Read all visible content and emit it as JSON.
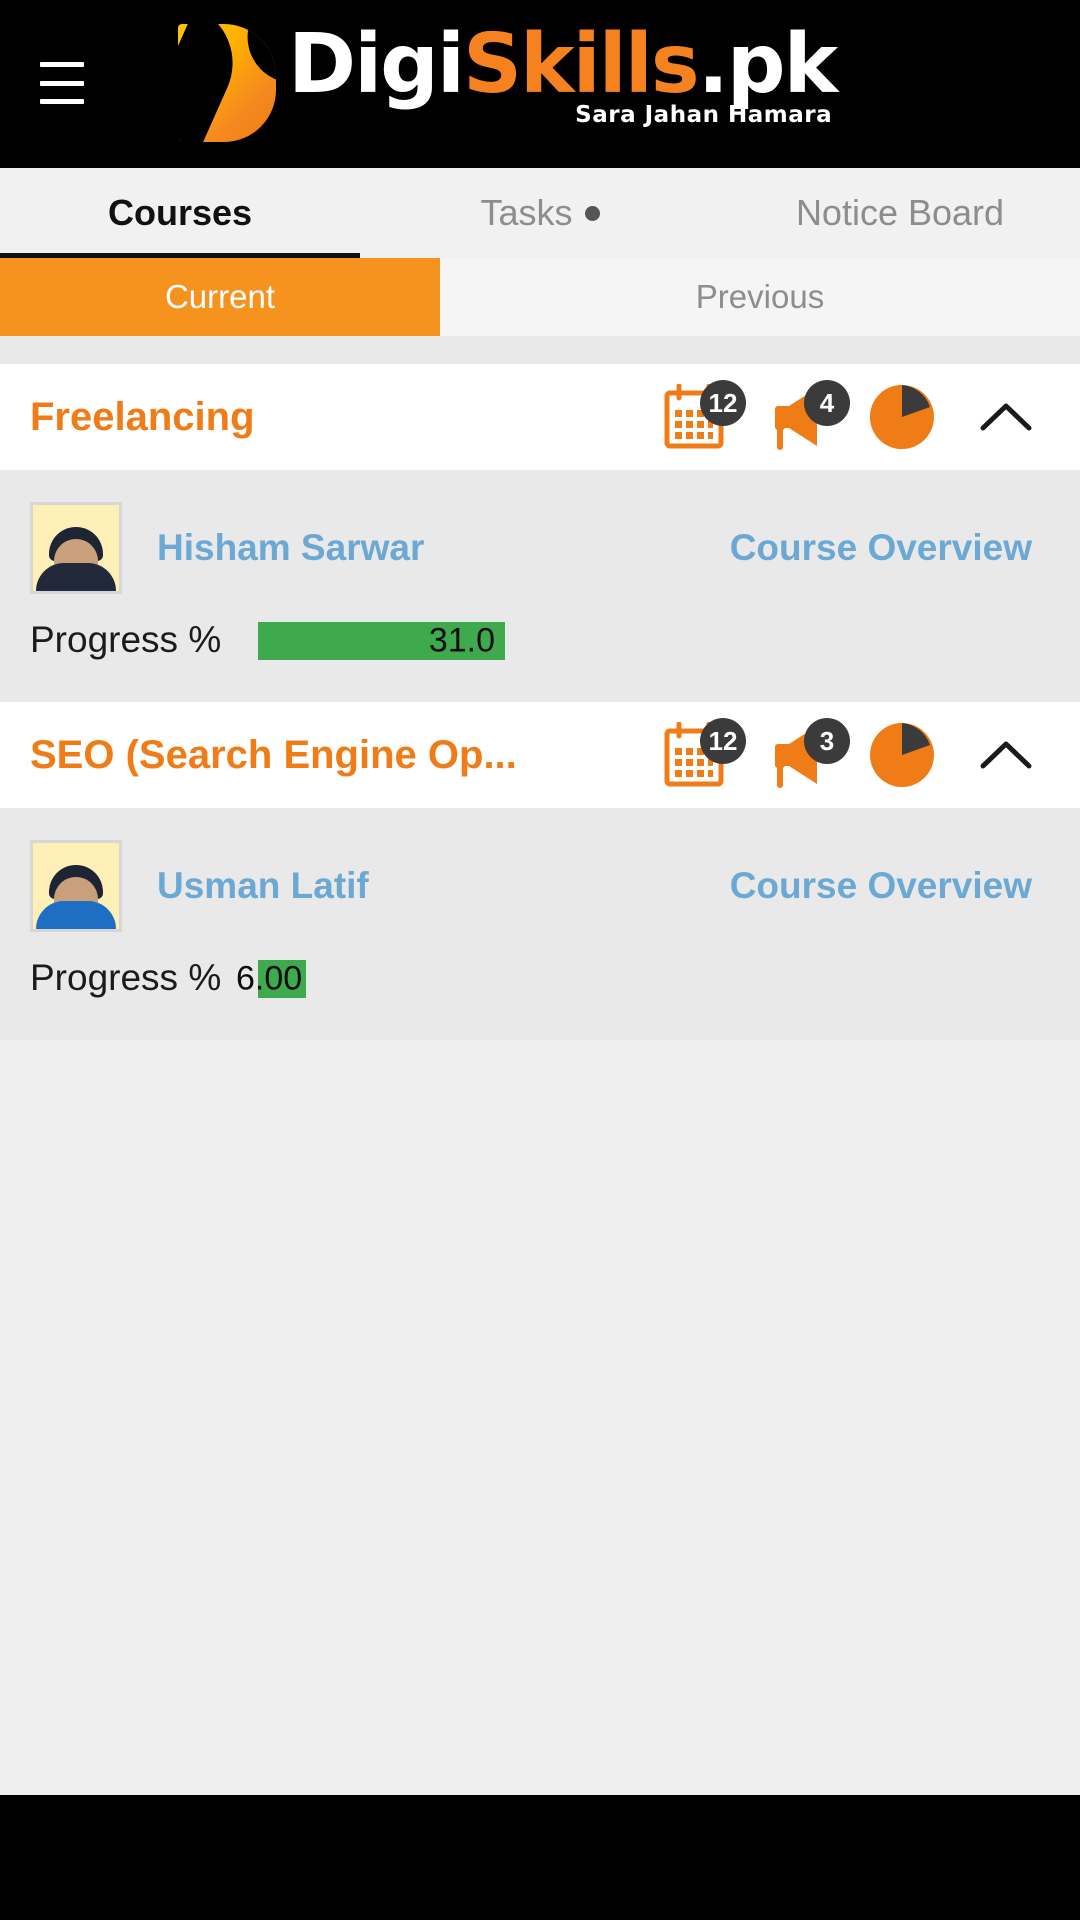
{
  "header": {
    "menu_icon": "hamburger-menu-icon",
    "logo": {
      "part1": "Digi",
      "part2": "Skills",
      "part3": ".pk",
      "tagline": "Sara Jahan Hamara"
    }
  },
  "tabs": [
    {
      "label": "Courses",
      "active": true,
      "dot": false
    },
    {
      "label": "Tasks",
      "active": false,
      "dot": true
    },
    {
      "label": "Notice Board",
      "active": false,
      "dot": false
    }
  ],
  "subtabs": {
    "current": "Current",
    "previous": "Previous"
  },
  "courses": [
    {
      "title": "Freelancing",
      "calendar_badge": "12",
      "announcement_badge": "4",
      "calendar_icon": "calendar-icon",
      "announcement_icon": "megaphone-icon",
      "grade_icon": "pie-chart-icon",
      "collapse_icon": "chevron-up-icon",
      "teacher": "Hisham Sarwar",
      "overview_label": "Course Overview",
      "progress_label": "Progress %",
      "progress_value": "31.0",
      "progress_percent": 31.0
    },
    {
      "title": "SEO (Search Engine Op...",
      "calendar_badge": "12",
      "announcement_badge": "3",
      "calendar_icon": "calendar-icon",
      "announcement_icon": "megaphone-icon",
      "grade_icon": "pie-chart-icon",
      "collapse_icon": "chevron-up-icon",
      "teacher": "Usman Latif",
      "overview_label": "Course Overview",
      "progress_label": "Progress %",
      "progress_value": "6.00",
      "progress_percent": 6.0
    }
  ],
  "colors": {
    "brand_orange": "#f6921e",
    "title_orange": "#f07c17",
    "link_blue": "#6ba8d4",
    "progress_green": "#3faa4d",
    "badge_dark": "#3b3b3b",
    "header_black": "#000000"
  }
}
